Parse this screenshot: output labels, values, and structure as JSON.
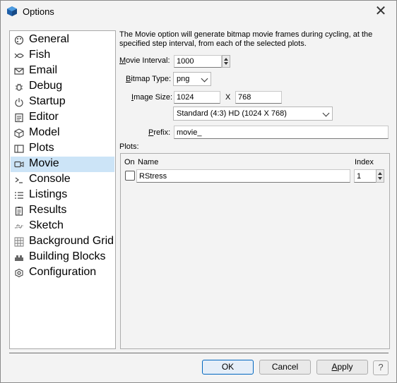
{
  "window": {
    "title": "Options",
    "close_glyph": "✕"
  },
  "sidebar": {
    "items": [
      {
        "label": "General",
        "icon": "palette-icon"
      },
      {
        "label": "Fish",
        "icon": "fish-icon"
      },
      {
        "label": "Email",
        "icon": "envelope-icon"
      },
      {
        "label": "Debug",
        "icon": "bug-icon"
      },
      {
        "label": "Startup",
        "icon": "power-icon"
      },
      {
        "label": "Editor",
        "icon": "editor-icon"
      },
      {
        "label": "Model",
        "icon": "cube-icon"
      },
      {
        "label": "Plots",
        "icon": "plots-icon"
      },
      {
        "label": "Movie",
        "icon": "movie-camera-icon"
      },
      {
        "label": "Console",
        "icon": "console-icon"
      },
      {
        "label": "Listings",
        "icon": "list-icon"
      },
      {
        "label": "Results",
        "icon": "clipboard-icon"
      },
      {
        "label": "Sketch",
        "icon": "sketch-icon"
      },
      {
        "label": "Background Grid",
        "icon": "grid-icon"
      },
      {
        "label": "Building Blocks",
        "icon": "blocks-icon"
      },
      {
        "label": "Configuration",
        "icon": "gear-icon"
      }
    ],
    "selected": "Movie"
  },
  "movie": {
    "description": "The Movie option will generate bitmap movie frames during cycling, at the specified step interval, from each of the selected plots.",
    "interval_label_key": "M",
    "interval_label_rest": "ovie Interval:",
    "interval_value": "1000",
    "bitmap_label_key": "B",
    "bitmap_label_rest": "itmap Type:",
    "bitmap_value": "png",
    "size_label_pre": "",
    "size_label_key": "I",
    "size_label_rest": "mage Size:",
    "width_value": "1024",
    "x_sep": "X",
    "height_value": "768",
    "preset_value": "Standard (4:3) HD (1024 X 768)",
    "prefix_label_key": "P",
    "prefix_label_rest": "refix:",
    "prefix_value": "movie_",
    "plots_label": "Plots:"
  },
  "plots_table": {
    "headers": {
      "on": "On",
      "name": "Name",
      "index": "Index"
    },
    "rows": [
      {
        "on": false,
        "name": "RStress",
        "index": "1"
      }
    ]
  },
  "buttons": {
    "ok": "OK",
    "cancel": "Cancel",
    "apply_key": "A",
    "apply_rest": "pply",
    "help": "?"
  }
}
